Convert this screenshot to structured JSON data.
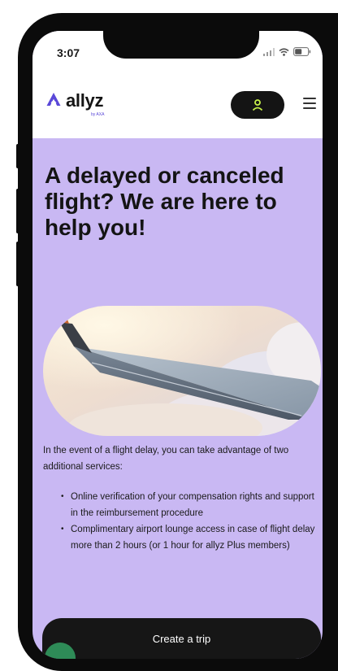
{
  "status_bar": {
    "time": "3:07",
    "icons": [
      "signal-icon",
      "wifi-icon",
      "battery-icon"
    ]
  },
  "header": {
    "logo": {
      "mark_icon": "allyz-logo-mark",
      "text": "allyz",
      "subtext": "by AXA",
      "brand_color": "#5a48d8"
    },
    "account_button_icon": "user-icon",
    "account_icon_color": "#c7f24a",
    "menu_icon": "hamburger-icon"
  },
  "hero": {
    "title": "A delayed or canceled flight? We are here to help you!",
    "image": "airplane-wing-over-clouds"
  },
  "content": {
    "intro": "In the event of a flight delay, you can take advantage of two additional services:",
    "benefits": [
      "Online verification of your compensation rights and support in the reimbursement procedure",
      "Complimentary airport lounge access in case of flight delay more than 2 hours (or 1 hour for allyz Plus members)"
    ]
  },
  "cta": {
    "label": "Create a trip"
  },
  "colors": {
    "page_background": "#c9b8f3",
    "dark": "#161616",
    "accent_green": "#c7f24a"
  }
}
